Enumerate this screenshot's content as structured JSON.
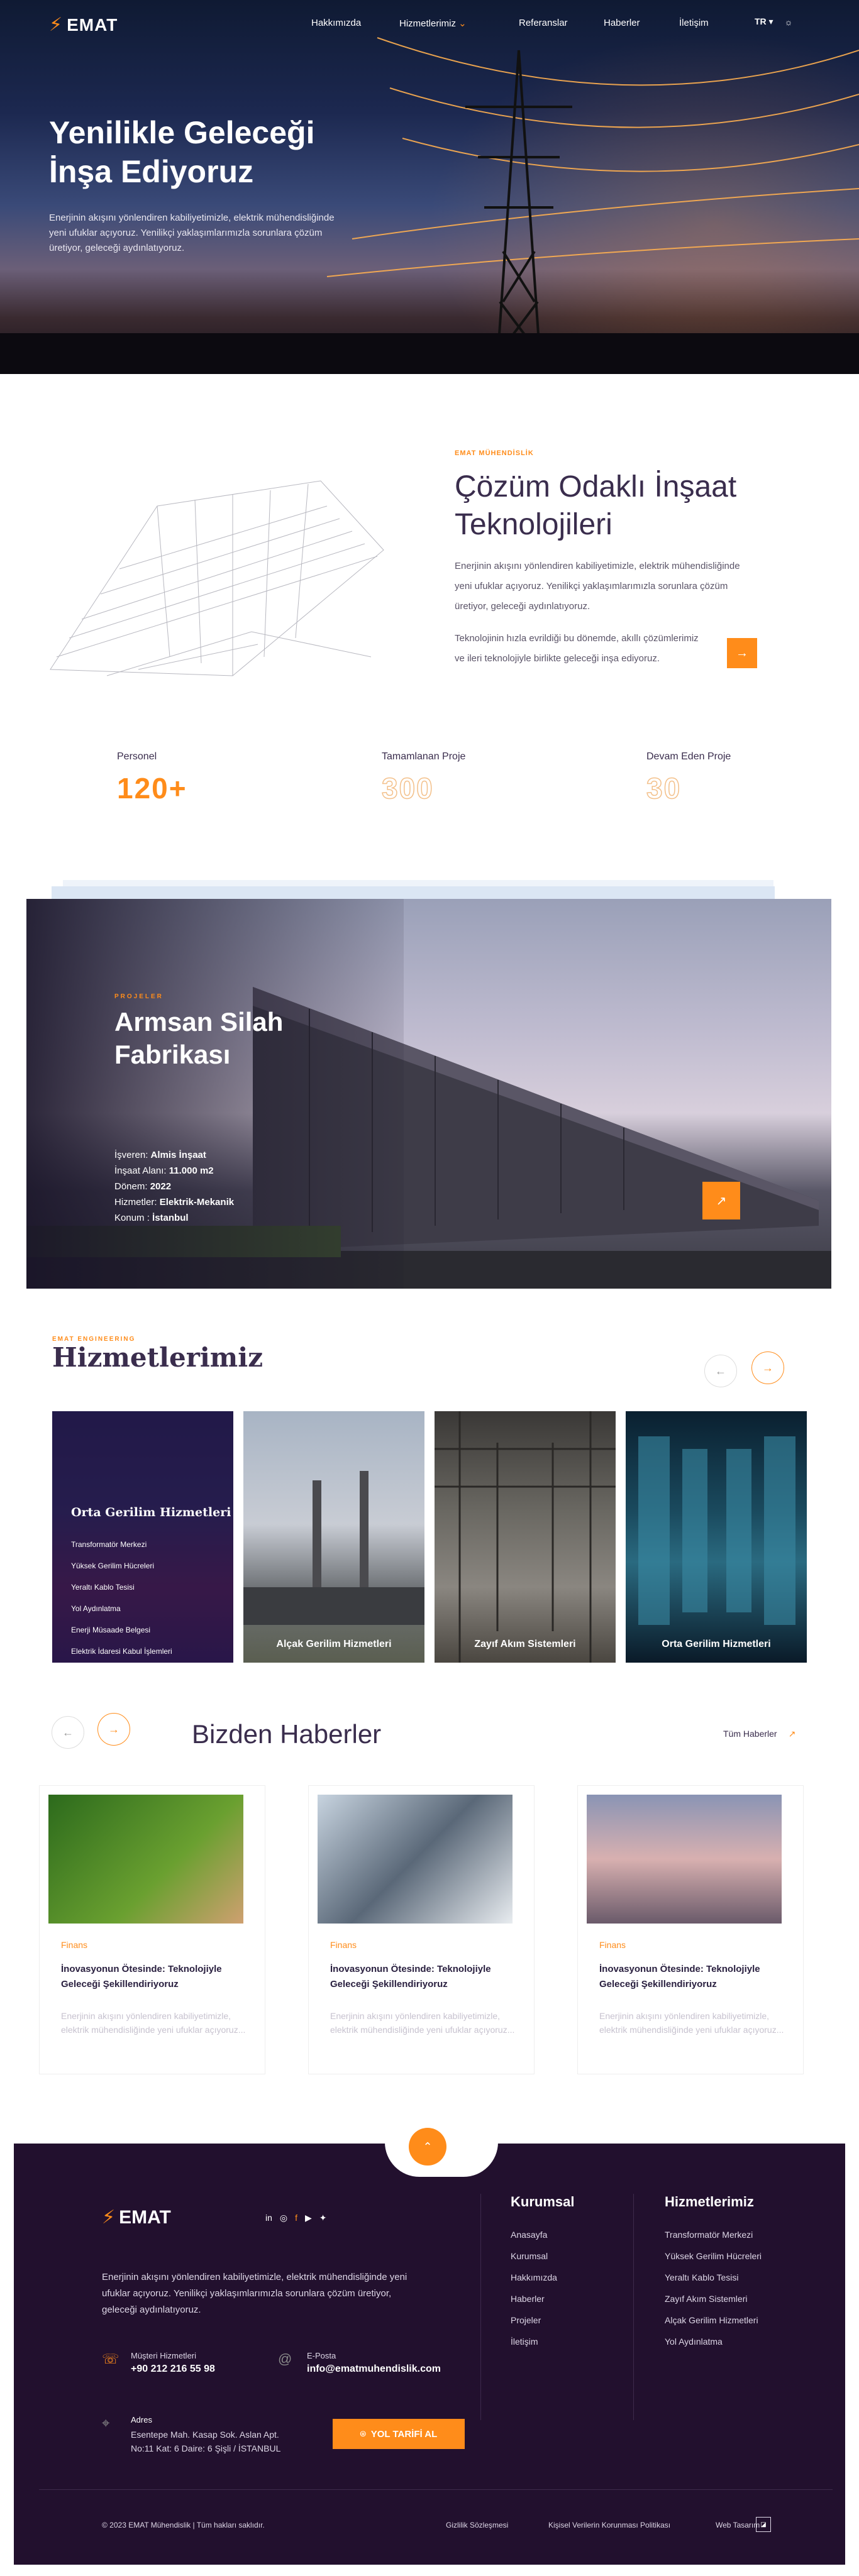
{
  "nav": {
    "logo": "EMAT",
    "links": [
      "Hakkımızda",
      "Hizmetlerimiz",
      "Referanslar",
      "Haberler",
      "İletişim"
    ],
    "lang": "TR"
  },
  "hero": {
    "title": "Yenilikle Geleceği İnşa Ediyoruz",
    "text": "Enerjinin akışını yönlendiren kabiliyetimizle, elektrik mühendisliğinde yeni ufuklar açıyoruz. Yenilikçi yaklaşımlarımızla sorunlara çözüm üretiyor, geleceği aydınlatıyoruz."
  },
  "about": {
    "tag": "EMAT MÜHENDİSLİK",
    "title": "Çözüm Odaklı İnşaat Teknolojileri",
    "p1": "Enerjinin akışını yönlendiren kabiliyetimizle, elektrik mühendisliğinde yeni ufuklar açıyoruz. Yenilikçi yaklaşımlarımızla sorunlara çözüm üretiyor, geleceği aydınlatıyoruz.",
    "p2": "Teknolojinin hızla evrildiği bu dönemde, akıllı çözümlerimiz ve ileri teknolojiyle birlikte geleceği inşa ediyoruz.",
    "stats": [
      {
        "label": "Personel",
        "value": "120+"
      },
      {
        "label": "Tamamlanan Proje",
        "value": "300"
      },
      {
        "label": "Devam Eden Proje",
        "value": "30"
      }
    ]
  },
  "project": {
    "tag": "PROJELER",
    "title": "Armsan Silah Fabrikası",
    "rows": [
      {
        "k": "İşveren:",
        "v": "Almis İnşaat"
      },
      {
        "k": "İnşaat Alanı:",
        "v": "11.000 m2"
      },
      {
        "k": "Dönem:",
        "v": "2022"
      },
      {
        "k": "Hizmetler:",
        "v": "Elektrik-Mekanik"
      },
      {
        "k": "Konum :",
        "v": "İstanbul"
      }
    ]
  },
  "services": {
    "tag": "EMAT ENGINEERING",
    "title": "Hizmetlerimiz",
    "featured": {
      "title": "Orta Gerilim Hizmetleri",
      "items": [
        "Transformatör Merkezi",
        "Yüksek Gerilim Hücreleri",
        "Yeraltı Kablo Tesisi",
        "Yol Aydınlatma",
        "Enerji Müsaade Belgesi",
        "Elektrik İdaresi Kabul İşlemleri"
      ]
    },
    "cards": [
      "Alçak Gerilim Hizmetleri",
      "Zayıf Akım Sistemleri",
      "Orta Gerilim Hizmetleri"
    ]
  },
  "news": {
    "title": "Bizden Haberler",
    "all": "Tüm Haberler",
    "items": [
      {
        "cat": "Finans",
        "title": "İnovasyonun Ötesinde: Teknolojiyle Geleceği Şekillendiriyoruz",
        "desc": "Enerjinin akışını yönlendiren kabiliyetimizle, elektrik mühendisliğinde yeni ufuklar açıyoruz..."
      },
      {
        "cat": "Finans",
        "title": "İnovasyonun Ötesinde: Teknolojiyle Geleceği Şekillendiriyoruz",
        "desc": "Enerjinin akışını yönlendiren kabiliyetimizle, elektrik mühendisliğinde yeni ufuklar açıyoruz..."
      },
      {
        "cat": "Finans",
        "title": "İnovasyonun Ötesinde: Teknolojiyle Geleceği Şekillendiriyoruz",
        "desc": "Enerjinin akışını yönlendiren kabiliyetimizle, elektrik mühendisliğinde yeni ufuklar açıyoruz..."
      }
    ]
  },
  "footer": {
    "logo": "EMAT",
    "desc": "Enerjinin akışını yönlendiren kabiliyetimizle, elektrik mühendisliğinde yeni ufuklar açıyoruz. Yenilikçi yaklaşımlarımızla sorunlara çözüm üretiyor, geleceği aydınlatıyoruz.",
    "phone_label": "Müşteri Hizmetleri",
    "phone": "+90 212 216 55 98",
    "email_label": "E-Posta",
    "email": "info@ematmuhendislik.com",
    "addr_label": "Adres",
    "addr": "Esentepe Mah. Kasap Sok. Aslan Apt. No:11 Kat: 6 Daire: 6 Şişli / İSTANBUL",
    "route": "YOL TARİFİ AL",
    "col1_title": "Kurumsal",
    "col1": [
      "Anasayfa",
      "Kurumsal",
      "Hakkımızda",
      "Haberler",
      "Projeler",
      "İletişim"
    ],
    "col2_title": "Hizmetlerimiz",
    "col2": [
      "Transformatör Merkezi",
      "Yüksek Gerilim Hücreleri",
      "Yeraltı Kablo Tesisi",
      "Zayıf Akım Sistemleri",
      "Alçak Gerilim Hizmetleri",
      "Yol Aydınlatma"
    ],
    "copyright": "© 2023 EMAT Mühendislik | Tüm hakları saklıdır.",
    "links": [
      "Gizlilik Sözleşmesi",
      "Kişisel Verilerin Korunması Politikası",
      "Web Tasarım"
    ]
  },
  "colors": {
    "accent": "#ff8c1a",
    "dark": "#22102e"
  }
}
